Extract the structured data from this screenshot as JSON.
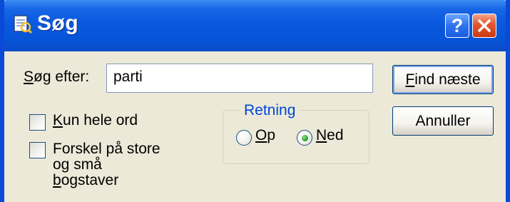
{
  "window": {
    "title": "Søg"
  },
  "titlebar": {
    "help_label": "?",
    "close_label": "✕"
  },
  "search": {
    "label": "Søg efter:",
    "label_accel": "S",
    "label_rest": "øg efter:",
    "value": "parti"
  },
  "options": {
    "whole_word": {
      "accel": "K",
      "rest": "un hele ord",
      "checked": false
    },
    "match_case": {
      "line1": "Forskel på store",
      "line2": "og små",
      "line3": "bogstaver",
      "line3_accel": "b",
      "line3_rest": "ogstaver",
      "checked": false
    }
  },
  "direction": {
    "title": "Retning",
    "up": {
      "accel": "O",
      "rest": "p",
      "selected": false
    },
    "down": {
      "accel": "N",
      "rest": "ed",
      "selected": true
    }
  },
  "buttons": {
    "find_next": {
      "accel": "F",
      "rest": "ind næste"
    },
    "cancel": "Annuller"
  },
  "colors": {
    "titlebar": "#0a59de",
    "dialog_bg": "#ece9d8",
    "group_title": "#0046d5",
    "radio_selected": "#2ca52c"
  }
}
